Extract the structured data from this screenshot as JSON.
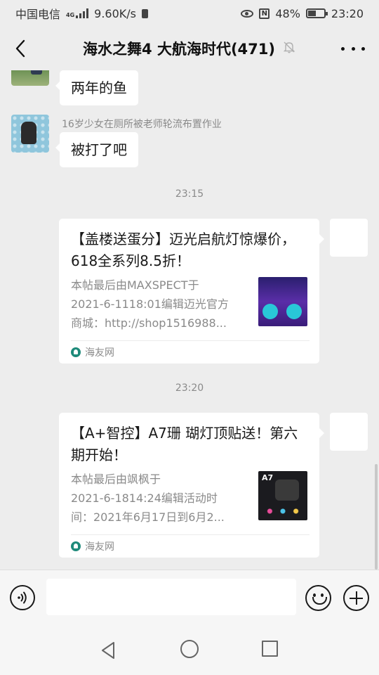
{
  "status_bar": {
    "carrier": "中国电信",
    "network_tag": "4G",
    "speed": "9.60K/s",
    "battery": "48%",
    "time": "23:20"
  },
  "header": {
    "title": "海水之舞4 大航海时代(471)",
    "muted": true
  },
  "messages": {
    "m1": {
      "text": "两年的鱼"
    },
    "m2": {
      "sender": "16岁少女在厕所被老师轮流布置作业",
      "text": "被打了吧"
    },
    "ts1": "23:15",
    "card1": {
      "title": "【盖楼送蛋分】迈光启航灯惊爆价，618全系列8.5折！",
      "desc": "本帖最后由MAXSPECT于\n2021-6-1118:01编辑迈光官方\n商城：http://shop1516988...",
      "source": "海友网"
    },
    "ts2": "23:20",
    "card2": {
      "title": "【A+智控】A7珊 瑚灯顶贴送！第六期开始！",
      "desc": "本帖最后由飒枫于\n2021-6-1814:24编辑活动时\n间：2021年6月17日到6月2...",
      "thumb_label": "A7",
      "source": "海友网"
    }
  },
  "input": {
    "placeholder": ""
  },
  "colors": {
    "chat_background": "#ededed",
    "bubble": "#ffffff",
    "meta_text": "#8a8a8a",
    "source_icon": "#1e8a7a"
  }
}
